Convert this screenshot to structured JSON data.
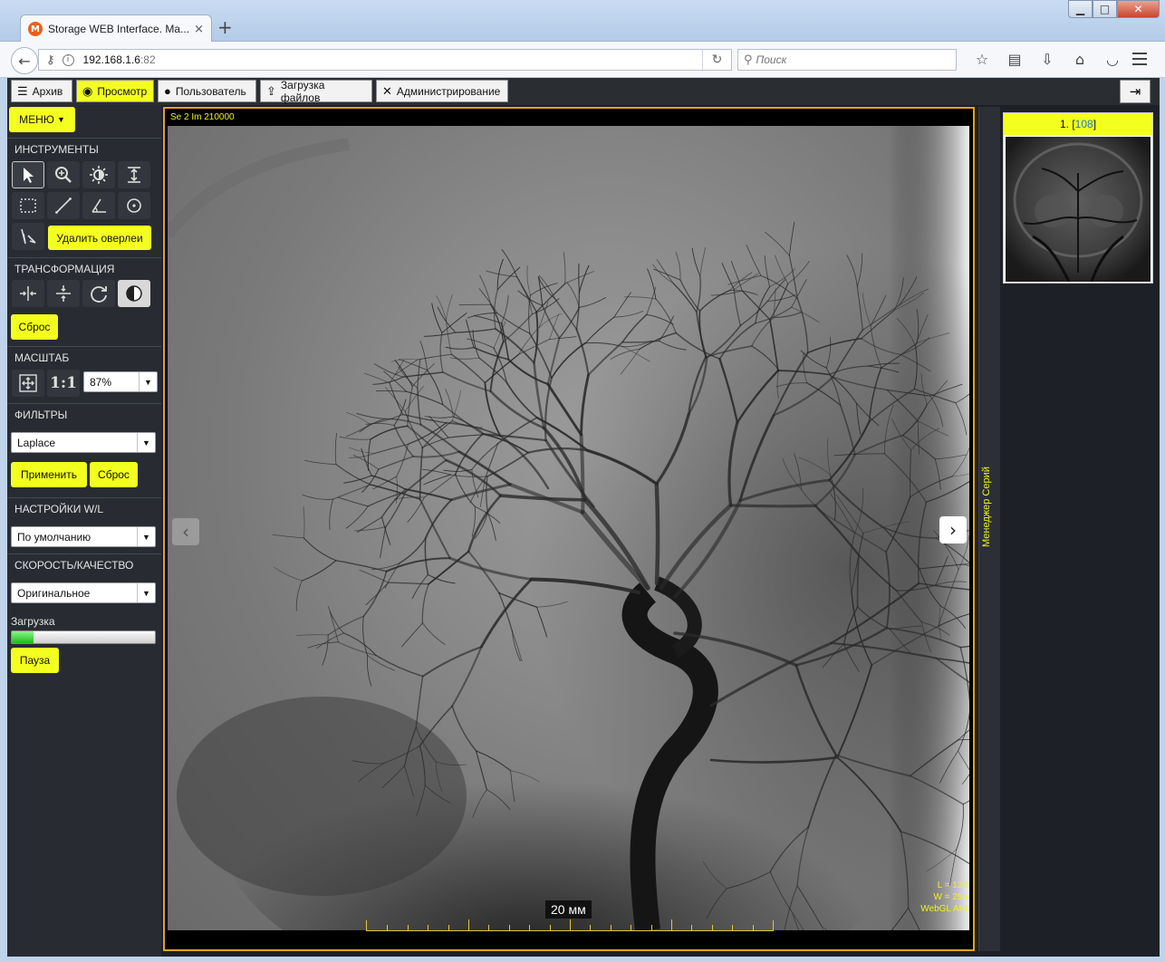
{
  "browser": {
    "tab_title": "Storage WEB Interface. Ma...",
    "tab_close": "×",
    "new_tab": "+",
    "url_host": "192.168.1.6",
    "url_port": ":82",
    "search_placeholder": "Поиск",
    "favicon_letter": "M"
  },
  "app": {
    "tabs": [
      {
        "label": "Архив"
      },
      {
        "label": "Просмотр"
      },
      {
        "label": "Пользователь"
      },
      {
        "label": "Загрузка файлов"
      },
      {
        "label": "Администрирование"
      }
    ],
    "active_tab": "Просмотр"
  },
  "sidebar": {
    "menu_label": "МЕНЮ",
    "sections": {
      "tools": "ИНСТРУМЕНТЫ",
      "transform": "ТРАНСФОРМАЦИЯ",
      "scale": "МАСШТАБ",
      "filters": "ФИЛЬТРЫ",
      "wl": "НАСТРОЙКИ W/L",
      "speed": "СКОРОСТЬ/КАЧЕСТВО"
    },
    "delete_overlays_label": "Удалить оверлеи",
    "reset_label": "Сброс",
    "zoom_1to1_label": "1:1",
    "zoom_value": "87%",
    "filter_value": "Laplace",
    "apply_label": "Применить",
    "filter_reset_label": "Сброс",
    "wl_value": "По умолчанию",
    "quality_value": "Оригинальное",
    "loading_label": "Загрузка",
    "loading_progress": 0.15,
    "pause_label": "Пауза"
  },
  "viewer": {
    "info_top": "Se 2 Im 210000",
    "wl_L": "L = 128",
    "wl_W": "W = 256",
    "renderer": "WebGL API",
    "scale_label": "20 мм"
  },
  "series_panel": {
    "strip_label": "Менеджер Серий",
    "item_index": "1.",
    "item_count": "108"
  },
  "colors": {
    "accent_yellow": "#f3ff1f",
    "viewer_border": "#e0a516",
    "overlay_text": "#f1f11a",
    "progress_green": "#1dbb1d"
  }
}
